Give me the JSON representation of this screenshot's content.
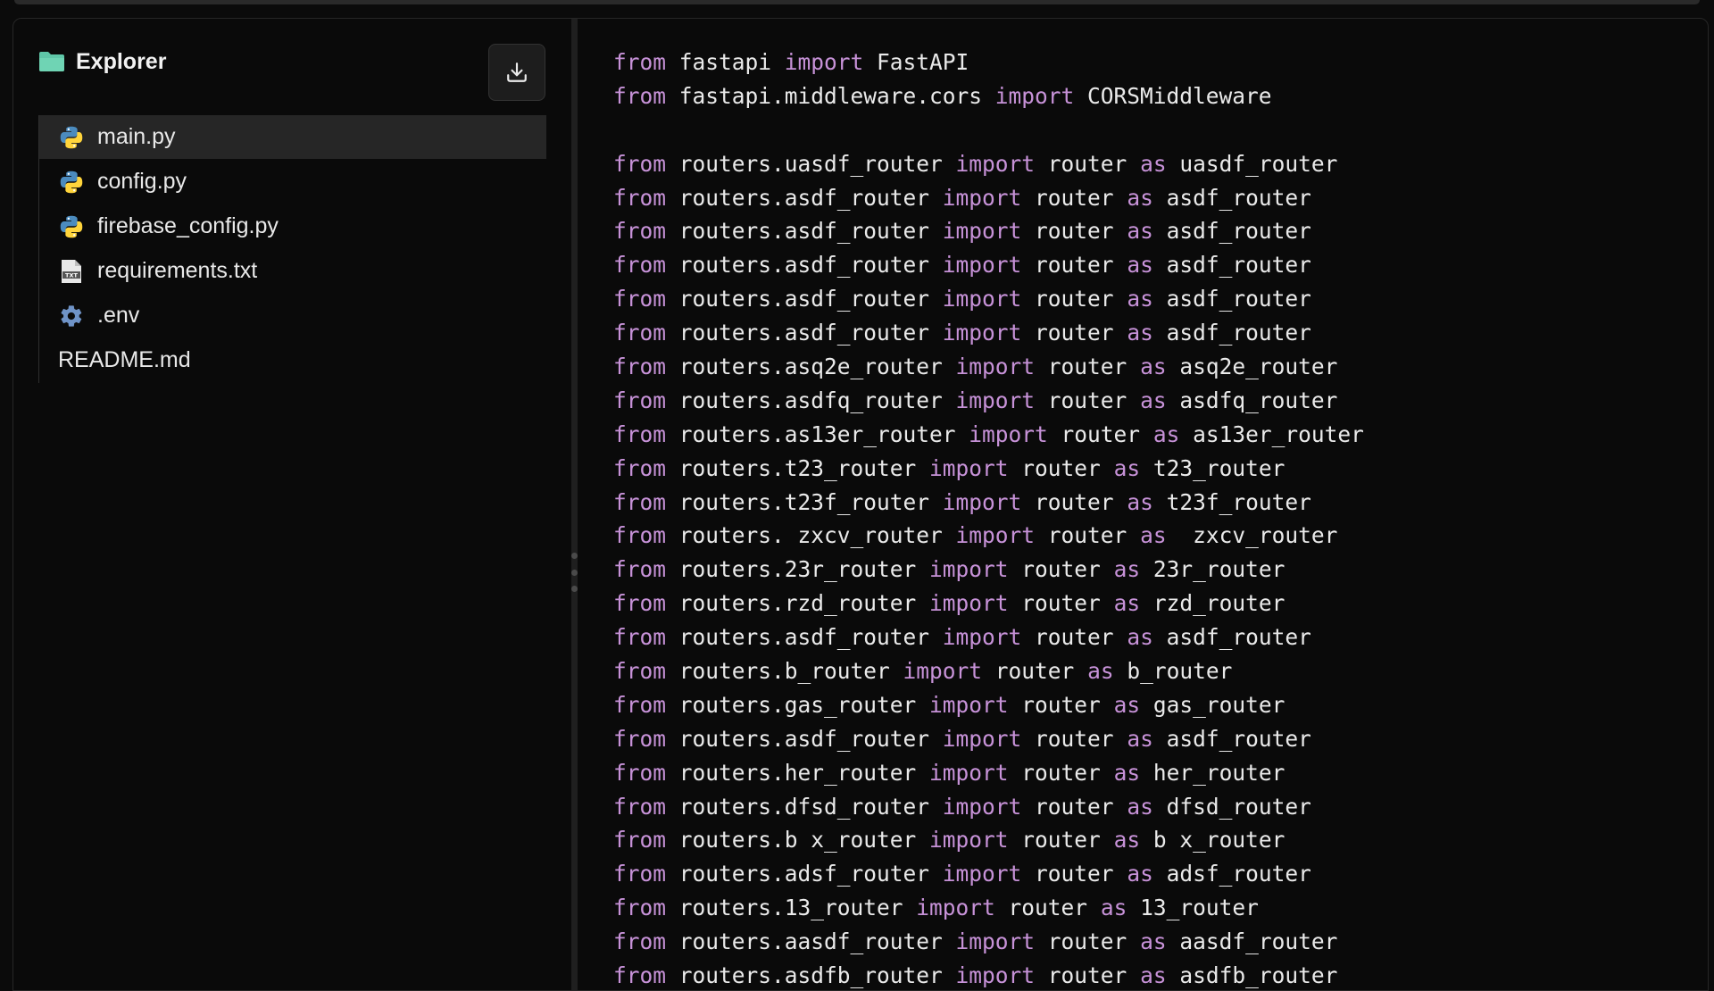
{
  "explorer": {
    "title": "Explorer",
    "files": [
      {
        "name": "main.py",
        "icon": "python-icon",
        "active": true
      },
      {
        "name": "config.py",
        "icon": "python-icon",
        "active": false
      },
      {
        "name": "firebase_config.py",
        "icon": "python-icon",
        "active": false
      },
      {
        "name": "requirements.txt",
        "icon": "text-file-icon",
        "active": false
      },
      {
        "name": ".env",
        "icon": "gear-icon",
        "active": false
      },
      {
        "name": "README.md",
        "icon": "none",
        "active": false
      }
    ]
  },
  "toolbar": {
    "download_icon": "download-icon"
  },
  "colors": {
    "keyword": "#c792d8",
    "text": "#eaeaea",
    "folder": "#5fc7a8"
  },
  "editor": {
    "lines": [
      [
        [
          "from",
          "kw"
        ],
        [
          " fastapi ",
          ""
        ],
        [
          "import",
          "kw"
        ],
        [
          " FastAPI",
          ""
        ]
      ],
      [
        [
          "from",
          "kw"
        ],
        [
          " fastapi.middleware.cors ",
          ""
        ],
        [
          "import",
          "kw"
        ],
        [
          " CORSMiddleware",
          ""
        ]
      ],
      [],
      [
        [
          "from",
          "kw"
        ],
        [
          " routers.uasdf_router ",
          ""
        ],
        [
          "import",
          "kw"
        ],
        [
          " router ",
          ""
        ],
        [
          "as",
          "kw"
        ],
        [
          " uasdf_router",
          ""
        ]
      ],
      [
        [
          "from",
          "kw"
        ],
        [
          " routers.asdf_router ",
          ""
        ],
        [
          "import",
          "kw"
        ],
        [
          " router ",
          ""
        ],
        [
          "as",
          "kw"
        ],
        [
          " asdf_router",
          ""
        ]
      ],
      [
        [
          "from",
          "kw"
        ],
        [
          " routers.asdf_router ",
          ""
        ],
        [
          "import",
          "kw"
        ],
        [
          " router ",
          ""
        ],
        [
          "as",
          "kw"
        ],
        [
          " asdf_router",
          ""
        ]
      ],
      [
        [
          "from",
          "kw"
        ],
        [
          " routers.asdf_router ",
          ""
        ],
        [
          "import",
          "kw"
        ],
        [
          " router ",
          ""
        ],
        [
          "as",
          "kw"
        ],
        [
          " asdf_router",
          ""
        ]
      ],
      [
        [
          "from",
          "kw"
        ],
        [
          " routers.asdf_router ",
          ""
        ],
        [
          "import",
          "kw"
        ],
        [
          " router ",
          ""
        ],
        [
          "as",
          "kw"
        ],
        [
          " asdf_router",
          ""
        ]
      ],
      [
        [
          "from",
          "kw"
        ],
        [
          " routers.asdf_router ",
          ""
        ],
        [
          "import",
          "kw"
        ],
        [
          " router ",
          ""
        ],
        [
          "as",
          "kw"
        ],
        [
          " asdf_router",
          ""
        ]
      ],
      [
        [
          "from",
          "kw"
        ],
        [
          " routers.asq2e_router ",
          ""
        ],
        [
          "import",
          "kw"
        ],
        [
          " router ",
          ""
        ],
        [
          "as",
          "kw"
        ],
        [
          " asq2e_router",
          ""
        ]
      ],
      [
        [
          "from",
          "kw"
        ],
        [
          " routers.asdfq_router ",
          ""
        ],
        [
          "import",
          "kw"
        ],
        [
          " router ",
          ""
        ],
        [
          "as",
          "kw"
        ],
        [
          " asdfq_router",
          ""
        ]
      ],
      [
        [
          "from",
          "kw"
        ],
        [
          " routers.as13er_router ",
          ""
        ],
        [
          "import",
          "kw"
        ],
        [
          " router ",
          ""
        ],
        [
          "as",
          "kw"
        ],
        [
          " as13er_router",
          ""
        ]
      ],
      [
        [
          "from",
          "kw"
        ],
        [
          " routers.t23_router ",
          ""
        ],
        [
          "import",
          "kw"
        ],
        [
          " router ",
          ""
        ],
        [
          "as",
          "kw"
        ],
        [
          " t23_router",
          ""
        ]
      ],
      [
        [
          "from",
          "kw"
        ],
        [
          " routers.t23f_router ",
          ""
        ],
        [
          "import",
          "kw"
        ],
        [
          " router ",
          ""
        ],
        [
          "as",
          "kw"
        ],
        [
          " t23f_router",
          ""
        ]
      ],
      [
        [
          "from",
          "kw"
        ],
        [
          " routers. zxcv_router ",
          ""
        ],
        [
          "import",
          "kw"
        ],
        [
          " router ",
          ""
        ],
        [
          "as",
          "kw"
        ],
        [
          "  zxcv_router",
          ""
        ]
      ],
      [
        [
          "from",
          "kw"
        ],
        [
          " routers.23r_router ",
          ""
        ],
        [
          "import",
          "kw"
        ],
        [
          " router ",
          ""
        ],
        [
          "as",
          "kw"
        ],
        [
          " 23r_router",
          ""
        ]
      ],
      [
        [
          "from",
          "kw"
        ],
        [
          " routers.rzd_router ",
          ""
        ],
        [
          "import",
          "kw"
        ],
        [
          " router ",
          ""
        ],
        [
          "as",
          "kw"
        ],
        [
          " rzd_router",
          ""
        ]
      ],
      [
        [
          "from",
          "kw"
        ],
        [
          " routers.asdf_router ",
          ""
        ],
        [
          "import",
          "kw"
        ],
        [
          " router ",
          ""
        ],
        [
          "as",
          "kw"
        ],
        [
          " asdf_router",
          ""
        ]
      ],
      [
        [
          "from",
          "kw"
        ],
        [
          " routers.b_router ",
          ""
        ],
        [
          "import",
          "kw"
        ],
        [
          " router ",
          ""
        ],
        [
          "as",
          "kw"
        ],
        [
          " b_router",
          ""
        ]
      ],
      [
        [
          "from",
          "kw"
        ],
        [
          " routers.gas_router ",
          ""
        ],
        [
          "import",
          "kw"
        ],
        [
          " router ",
          ""
        ],
        [
          "as",
          "kw"
        ],
        [
          " gas_router",
          ""
        ]
      ],
      [
        [
          "from",
          "kw"
        ],
        [
          " routers.asdf_router ",
          ""
        ],
        [
          "import",
          "kw"
        ],
        [
          " router ",
          ""
        ],
        [
          "as",
          "kw"
        ],
        [
          " asdf_router",
          ""
        ]
      ],
      [
        [
          "from",
          "kw"
        ],
        [
          " routers.her_router ",
          ""
        ],
        [
          "import",
          "kw"
        ],
        [
          " router ",
          ""
        ],
        [
          "as",
          "kw"
        ],
        [
          " her_router",
          ""
        ]
      ],
      [
        [
          "from",
          "kw"
        ],
        [
          " routers.dfsd_router ",
          ""
        ],
        [
          "import",
          "kw"
        ],
        [
          " router ",
          ""
        ],
        [
          "as",
          "kw"
        ],
        [
          " dfsd_router",
          ""
        ]
      ],
      [
        [
          "from",
          "kw"
        ],
        [
          " routers.b x_router ",
          ""
        ],
        [
          "import",
          "kw"
        ],
        [
          " router ",
          ""
        ],
        [
          "as",
          "kw"
        ],
        [
          " b x_router",
          ""
        ]
      ],
      [
        [
          "from",
          "kw"
        ],
        [
          " routers.adsf_router ",
          ""
        ],
        [
          "import",
          "kw"
        ],
        [
          " router ",
          ""
        ],
        [
          "as",
          "kw"
        ],
        [
          " adsf_router",
          ""
        ]
      ],
      [
        [
          "from",
          "kw"
        ],
        [
          " routers.13_router ",
          ""
        ],
        [
          "import",
          "kw"
        ],
        [
          " router ",
          ""
        ],
        [
          "as",
          "kw"
        ],
        [
          " 13_router",
          ""
        ]
      ],
      [
        [
          "from",
          "kw"
        ],
        [
          " routers.aasdf_router ",
          ""
        ],
        [
          "import",
          "kw"
        ],
        [
          " router ",
          ""
        ],
        [
          "as",
          "kw"
        ],
        [
          " aasdf_router",
          ""
        ]
      ],
      [
        [
          "from",
          "kw"
        ],
        [
          " routers.asdfb_router ",
          ""
        ],
        [
          "import",
          "kw"
        ],
        [
          " router ",
          ""
        ],
        [
          "as",
          "kw"
        ],
        [
          " asdfb_router",
          ""
        ]
      ]
    ]
  }
}
